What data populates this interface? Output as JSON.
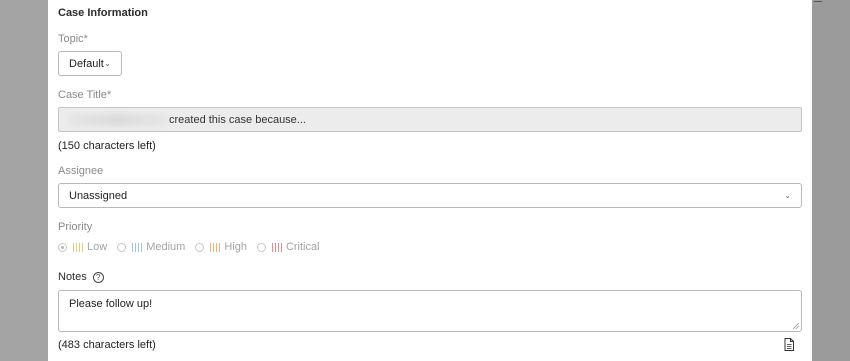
{
  "form": {
    "section_title": "Case Information",
    "topic": {
      "label": "Topic*",
      "value": "Default"
    },
    "case_title": {
      "label": "Case Title*",
      "value_suffix": "created this case because...",
      "chars_left": "(150 characters left)"
    },
    "assignee": {
      "label": "Assignee",
      "value": "Unassigned"
    },
    "priority": {
      "label": "Priority",
      "options": [
        {
          "label": "Low",
          "color": "#e8c77a",
          "selected": true
        },
        {
          "label": "Medium",
          "color": "#9fc3e8",
          "selected": false
        },
        {
          "label": "High",
          "color": "#f1b27a",
          "selected": false
        },
        {
          "label": "Critical",
          "color": "#e88a8a",
          "selected": false
        }
      ]
    },
    "notes": {
      "label": "Notes",
      "help_icon": "?",
      "value": "Please follow up!",
      "chars_left": "(483 characters left)"
    }
  },
  "icons": {
    "topic_chevron": "chevron-down-icon",
    "assignee_chevron": "chevron-down-icon",
    "help": "question-circle-icon",
    "document": "document-icon",
    "resize": "resize-grip-icon"
  }
}
